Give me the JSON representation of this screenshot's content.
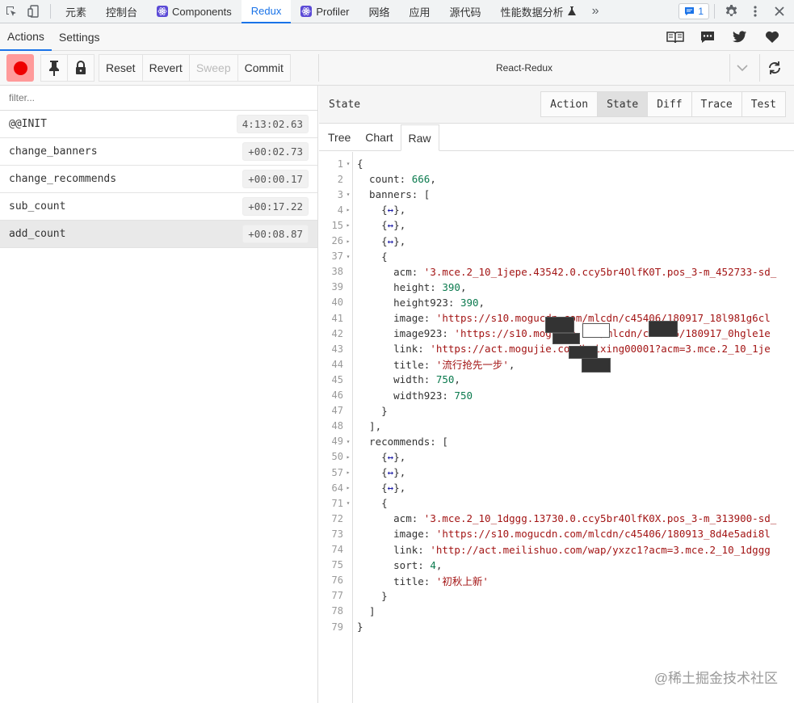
{
  "topbar": {
    "tabs": [
      {
        "label": "元素"
      },
      {
        "label": "控制台"
      },
      {
        "label": "Components"
      },
      {
        "label": "Redux"
      },
      {
        "label": "Profiler"
      },
      {
        "label": "网络"
      },
      {
        "label": "应用"
      },
      {
        "label": "源代码"
      },
      {
        "label": "性能数据分析"
      }
    ],
    "more": "»",
    "badge_count": "1"
  },
  "subbar": {
    "tabs": [
      "Actions",
      "Settings"
    ]
  },
  "toolbar": {
    "reset": "Reset",
    "revert": "Revert",
    "sweep": "Sweep",
    "commit": "Commit",
    "instance": "React-Redux"
  },
  "left": {
    "filter_placeholder": "filter...",
    "actions": [
      {
        "name": "@@INIT",
        "time": "4:13:02.63"
      },
      {
        "name": "change_banners",
        "time": "+00:02.73"
      },
      {
        "name": "change_recommends",
        "time": "+00:00.17"
      },
      {
        "name": "sub_count",
        "time": "+00:17.22"
      },
      {
        "name": "add_count",
        "time": "+00:08.87"
      }
    ]
  },
  "right": {
    "title": "State",
    "segments": [
      "Action",
      "State",
      "Diff",
      "Trace",
      "Test"
    ],
    "view_tabs": [
      "Tree",
      "Chart",
      "Raw"
    ]
  },
  "code": [
    {
      "n": "1",
      "f": "▾",
      "t": "{"
    },
    {
      "n": "2",
      "f": "",
      "t": "  count: 666,"
    },
    {
      "n": "3",
      "f": "▾",
      "t": "  banners: ["
    },
    {
      "n": "4",
      "f": "▸",
      "t": "    {↔},"
    },
    {
      "n": "15",
      "f": "▸",
      "t": "    {↔},"
    },
    {
      "n": "26",
      "f": "▸",
      "t": "    {↔},"
    },
    {
      "n": "37",
      "f": "▾",
      "t": "    {"
    },
    {
      "n": "38",
      "f": "",
      "t": "      acm: '3.mce.2_10_1jepe.43542.0.ccy5br4OlfK0T.pos_3-m_452733-sd_"
    },
    {
      "n": "39",
      "f": "",
      "t": "      height: 390,"
    },
    {
      "n": "40",
      "f": "",
      "t": "      height923: 390,"
    },
    {
      "n": "41",
      "f": "",
      "t": "      image: 'https://s10.mogucdn.com/mlcdn/c45406/180917_18l981g6cl"
    },
    {
      "n": "42",
      "f": "",
      "t": "      image923: 'https://s10.mogucdn.com/mlcdn/c45406/180917_0hgle1e"
    },
    {
      "n": "43",
      "f": "",
      "t": "      link: 'https://act.mogujie.com/huixing00001?acm=3.mce.2_10_1je"
    },
    {
      "n": "44",
      "f": "",
      "t": "      title: '流行抢先一步',"
    },
    {
      "n": "45",
      "f": "",
      "t": "      width: 750,"
    },
    {
      "n": "46",
      "f": "",
      "t": "      width923: 750"
    },
    {
      "n": "47",
      "f": "",
      "t": "    }"
    },
    {
      "n": "48",
      "f": "",
      "t": "  ],"
    },
    {
      "n": "49",
      "f": "▾",
      "t": "  recommends: ["
    },
    {
      "n": "50",
      "f": "▸",
      "t": "    {↔},"
    },
    {
      "n": "57",
      "f": "▸",
      "t": "    {↔},"
    },
    {
      "n": "64",
      "f": "▸",
      "t": "    {↔},"
    },
    {
      "n": "71",
      "f": "▾",
      "t": "    {"
    },
    {
      "n": "72",
      "f": "",
      "t": "      acm: '3.mce.2_10_1dggg.13730.0.ccy5br4OlfK0X.pos_3-m_313900-sd_"
    },
    {
      "n": "73",
      "f": "",
      "t": "      image: 'https://s10.mogucdn.com/mlcdn/c45406/180913_8d4e5adi8l"
    },
    {
      "n": "74",
      "f": "",
      "t": "      link: 'http://act.meilishuo.com/wap/yxzc1?acm=3.mce.2_10_1dggg"
    },
    {
      "n": "75",
      "f": "",
      "t": "      sort: 4,"
    },
    {
      "n": "76",
      "f": "",
      "t": "      title: '初秋上新'"
    },
    {
      "n": "77",
      "f": "",
      "t": "    }"
    },
    {
      "n": "78",
      "f": "",
      "t": "  ]"
    },
    {
      "n": "79",
      "f": "",
      "t": "}"
    }
  ],
  "watermark": "@稀土掘金技术社区"
}
